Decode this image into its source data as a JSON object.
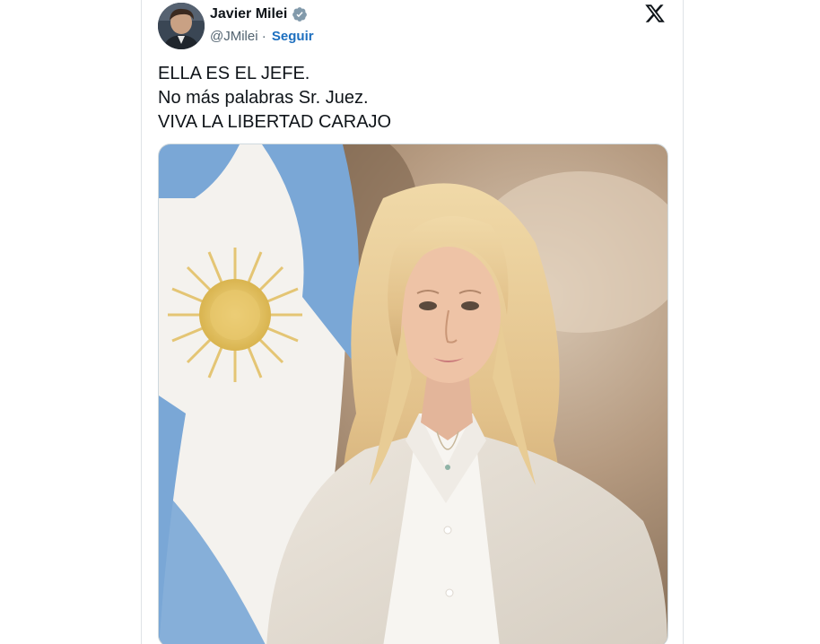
{
  "tweet": {
    "author": {
      "display_name": "Javier Milei",
      "handle": "@JMilei",
      "separator": "·",
      "follow_label": "Seguir",
      "verified": true,
      "avatar_icon": "profile-photo"
    },
    "platform_icon": "x-logo-icon",
    "text_lines": [
      "ELLA ES EL JEFE.",
      "No más palabras Sr. Juez.",
      "VIVA LA LIBERTAD CARAJO"
    ],
    "media": {
      "kind": "photo",
      "description_icon": "portrait-photo"
    }
  },
  "colors": {
    "verified_badge": "#829aab",
    "follow_link": "#1d6fbf",
    "text": "#0f1419",
    "muted": "#536471",
    "flag_blue": "#75aadb",
    "sun": "#f6b40e"
  }
}
